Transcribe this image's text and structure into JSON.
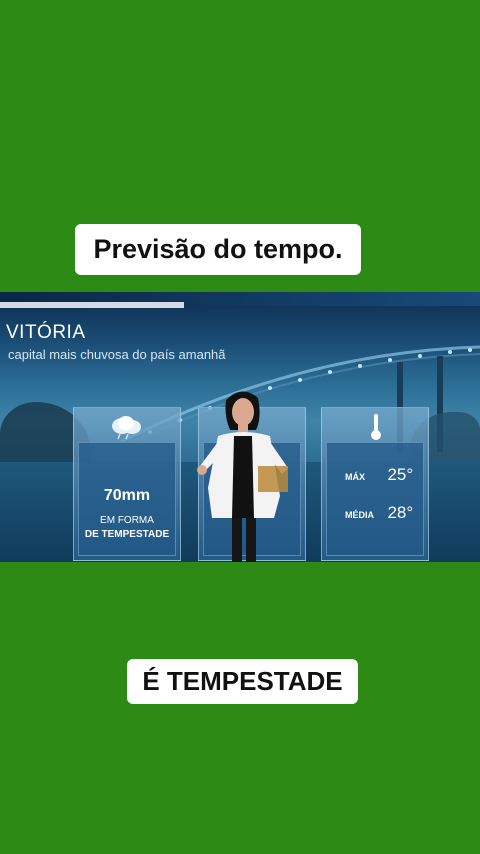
{
  "captions": {
    "top": "Previsão do tempo.",
    "bottom": "É TEMPESTADE"
  },
  "video": {
    "city": "VITÓRIA",
    "subtitle": "capital mais chuvosa do país amanhã",
    "rain": {
      "value": "70mm",
      "line1": "EM FORMA",
      "line2": "DE TEMPESTADE",
      "icon": "storm-cloud-icon"
    },
    "temperature": {
      "max_label": "MÁX",
      "max_value": "25°",
      "avg_label": "MÉDIA",
      "avg_value": "28°",
      "icon": "thermometer-icon"
    }
  },
  "colors": {
    "background": "#2d8a14",
    "caption_bg": "#ffffff",
    "panel": "#2a6696"
  }
}
